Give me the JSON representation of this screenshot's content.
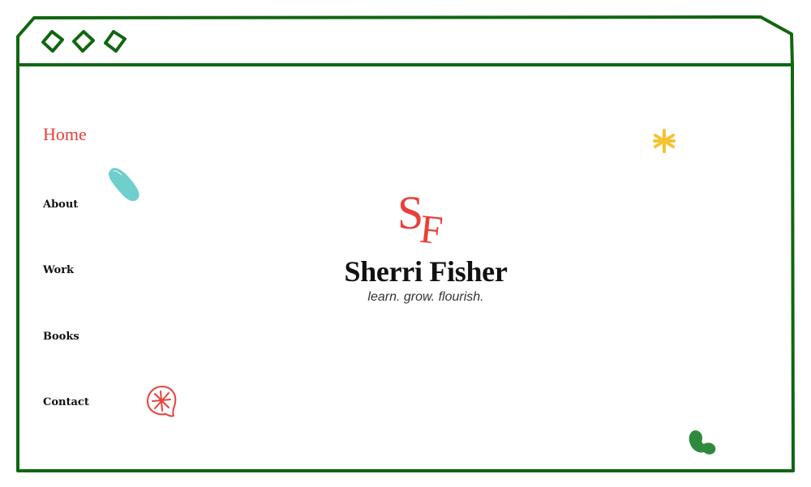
{
  "window": {
    "controls": [
      "window-control-icon",
      "window-control-icon",
      "window-control-icon"
    ]
  },
  "nav": {
    "items": [
      {
        "label": "Home",
        "active": true
      },
      {
        "label": "About",
        "active": false
      },
      {
        "label": "Work",
        "active": false
      },
      {
        "label": "Books",
        "active": false
      },
      {
        "label": "Contact",
        "active": false
      }
    ]
  },
  "hero": {
    "logo_letters": "SF",
    "title": "Sherri Fisher",
    "tagline": "learn. grow. flourish."
  },
  "colors": {
    "frame": "#116611",
    "accent_red": "#e9403a",
    "teal": "#6fcfcc",
    "yellow": "#f6c334",
    "green": "#2f8a3e"
  },
  "icons": {
    "teal_blob": "teal-brush-stroke-icon",
    "yellow_star": "asterisk-icon",
    "red_doodle": "red-circle-doodle-icon",
    "green_blob": "green-blob-icon"
  }
}
